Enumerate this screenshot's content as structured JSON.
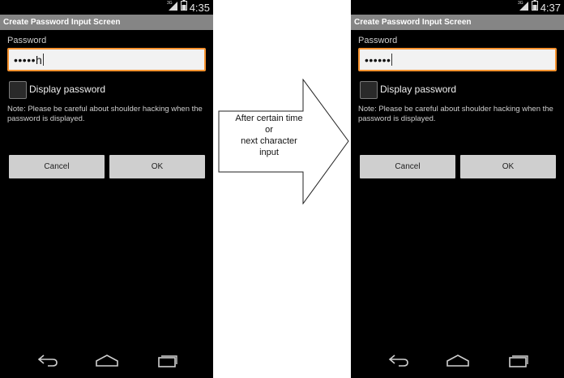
{
  "left_screen": {
    "status": {
      "time": "4:35",
      "network_label": "3G"
    },
    "title": "Create Password Input Screen",
    "password": {
      "label": "Password",
      "value": "•••••h"
    },
    "checkbox": {
      "label": "Display password",
      "checked": false
    },
    "note": "Note: Please be careful about shoulder hacking when the password is displayed.",
    "buttons": {
      "cancel": "Cancel",
      "ok": "OK"
    }
  },
  "right_screen": {
    "status": {
      "time": "4:37",
      "network_label": "3G"
    },
    "title": "Create Password Input Screen",
    "password": {
      "label": "Password",
      "value": "••••••"
    },
    "checkbox": {
      "label": "Display password",
      "checked": false
    },
    "note": "Note: Please be careful about shoulder hacking when the password is displayed.",
    "buttons": {
      "cancel": "Cancel",
      "ok": "OK"
    }
  },
  "arrow": {
    "lines": [
      "After certain time",
      "or",
      "next character",
      "input"
    ]
  },
  "icons": {
    "signal": "signal-icon",
    "battery": "battery-icon",
    "back": "back-icon",
    "home": "home-icon",
    "recents": "recent-apps-icon"
  },
  "colors": {
    "screen_background": "#000000",
    "title_bar": "#858585",
    "field_border_focus": "#f7922e",
    "button": "#cfcfcf"
  }
}
